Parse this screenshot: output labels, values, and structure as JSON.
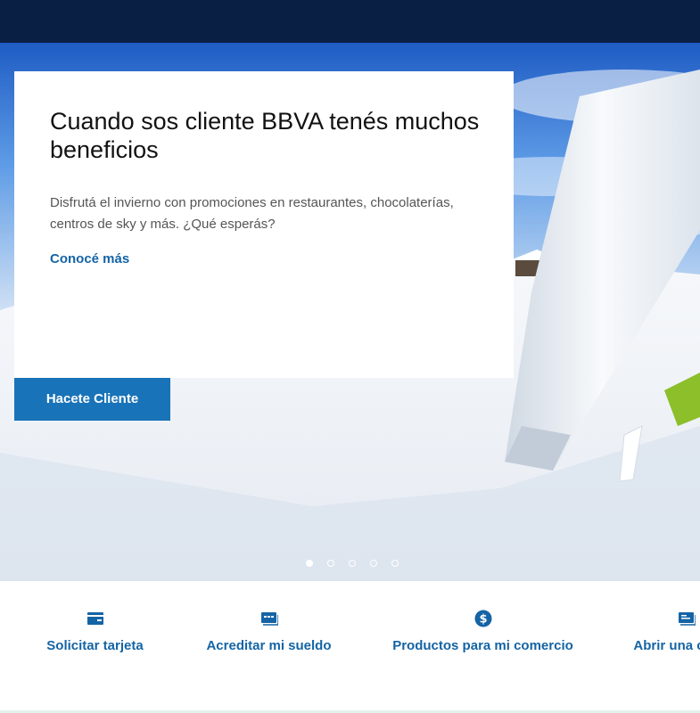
{
  "hero": {
    "title": "Cuando sos cliente BBVA tenés muchos beneficios",
    "description": "Disfrutá el invierno con promociones en restaurantes, chocolaterías, centros de sky y más. ¿Qué esperás?",
    "link_label": "Conocé más",
    "cta_label": "Hacete Cliente",
    "slides_total": 5,
    "active_slide": 1
  },
  "quick_actions": [
    {
      "label": "Solicitar tarjeta",
      "icon": "card-icon"
    },
    {
      "label": "Acreditar mi sueldo",
      "icon": "salary-card-icon"
    },
    {
      "label": "Productos para mi comercio",
      "icon": "dollar-icon"
    },
    {
      "label": "Abrir una cuenta",
      "icon": "account-icon"
    }
  ],
  "colors": {
    "topbar": "#0a1f44",
    "link": "#1464a5",
    "cta": "#1973b8"
  }
}
